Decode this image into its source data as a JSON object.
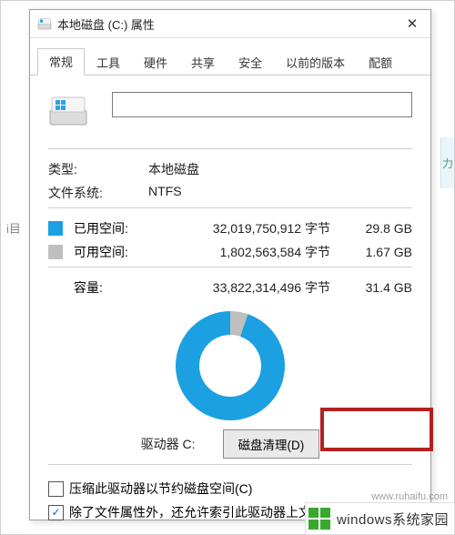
{
  "window": {
    "title": "本地磁盘 (C:) 属性",
    "close_glyph": "✕"
  },
  "tabs": [
    {
      "label": "常规",
      "active": true
    },
    {
      "label": "工具"
    },
    {
      "label": "硬件"
    },
    {
      "label": "共享"
    },
    {
      "label": "安全"
    },
    {
      "label": "以前的版本"
    },
    {
      "label": "配额"
    }
  ],
  "general": {
    "name_value": "",
    "type_label": "类型:",
    "type_value": "本地磁盘",
    "fs_label": "文件系统:",
    "fs_value": "NTFS",
    "used_label": "已用空间:",
    "used_bytes": "32,019,750,912 字节",
    "used_gb": "29.8 GB",
    "free_label": "可用空间:",
    "free_bytes": "1,802,563,584 字节",
    "free_gb": "1.67 GB",
    "cap_label": "容量:",
    "cap_bytes": "33,822,314,496 字节",
    "cap_gb": "31.4 GB",
    "drive_label": "驱动器 C:",
    "cleanup_label": "磁盘清理(D)",
    "compress_label": "压缩此驱动器以节约磁盘空间(C)",
    "index_label": "除了文件属性外，还允许索引此驱动器上文件的"
  },
  "chart_data": {
    "type": "pie",
    "title": "驱动器 C:",
    "series": [
      {
        "name": "已用空间",
        "value": 32019750912,
        "display": "29.8 GB",
        "color": "#1ba0e1"
      },
      {
        "name": "可用空间",
        "value": 1802563584,
        "display": "1.67 GB",
        "color": "#bfbfbf"
      }
    ],
    "total": {
      "value": 33822314496,
      "display": "31.4 GB"
    }
  },
  "watermark": {
    "text": "windows系统家园",
    "url": "www.ruhaifu.com"
  },
  "stray": {
    "left": "i目",
    "right": "力"
  }
}
